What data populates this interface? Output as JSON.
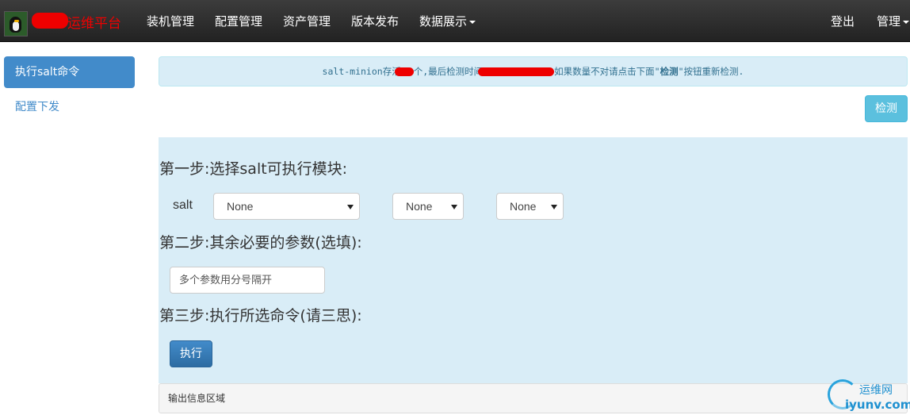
{
  "navbar": {
    "brand_text": "运维平台",
    "items": [
      "装机管理",
      "配置管理",
      "资产管理",
      "版本发布",
      "数据展示"
    ],
    "right_items": [
      "登出",
      "管理"
    ],
    "background": "#222222",
    "brand_color": "#ee0000"
  },
  "sidebar": {
    "items": [
      {
        "label": "执行salt命令",
        "active": true
      },
      {
        "label": "配置下发",
        "active": false
      }
    ],
    "accent": "#428bca"
  },
  "alert": {
    "prefix": "salt-minion存活",
    "mid": "个,最后检测时间",
    "suffix_before_bold": "如果数量不对请点击下面\"",
    "bold": "检测",
    "suffix_after_bold": "\"按钮重新检测."
  },
  "check_button": {
    "label": "检测",
    "color": "#5bc0de"
  },
  "steps": {
    "step1": "第一步:选择salt可执行模块:",
    "step2": "第二步:其余必要的参数(选填):",
    "step3": "第三步:执行所选命令(请三思):"
  },
  "salt_label": "salt",
  "selects": [
    {
      "value": "None"
    },
    {
      "value": "None"
    },
    {
      "value": "None"
    }
  ],
  "params_input": {
    "placeholder": "多个参数用分号隔开",
    "value": ""
  },
  "run_button": {
    "label": "执行"
  },
  "output": {
    "label": "输出信息区域"
  },
  "watermark": {
    "cn": "运维网",
    "url": "iyunv.com"
  }
}
